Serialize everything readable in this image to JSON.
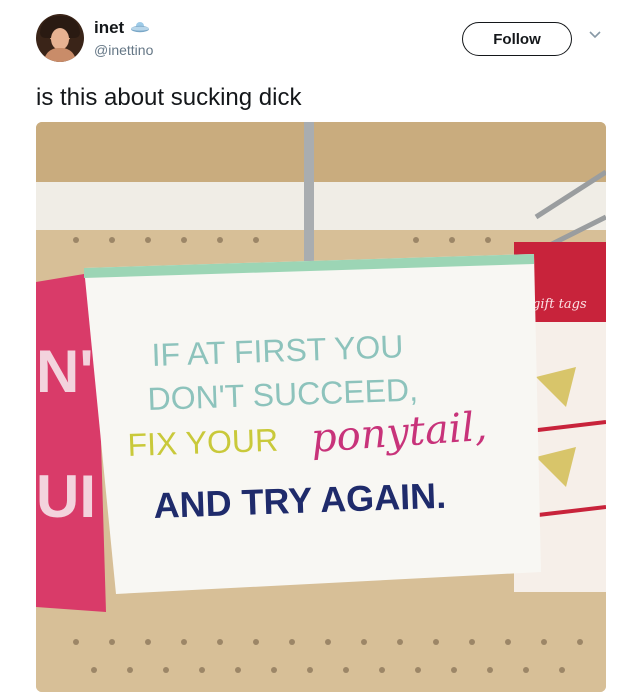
{
  "author": {
    "display_name": "inet",
    "handle": "@inettino",
    "badge_icon": "ufo-icon"
  },
  "follow_label": "Follow",
  "tweet_text": "is this about sucking dick",
  "photo": {
    "sign_lines": [
      "IF AT FIRST YOU",
      "DON'T SUCCEED,",
      "FIX YOUR",
      "ponytail,",
      "AND TRY AGAIN."
    ],
    "tag_text": "gift tags",
    "pink_sign_fragment_1": "N'",
    "pink_sign_fragment_2": "UI"
  },
  "colors": {
    "accent": "#1da1f2",
    "sign_teal": "#8dc3bc",
    "sign_yellow": "#c9c93a",
    "sign_magenta": "#c8337a",
    "sign_navy": "#1f2b6b",
    "pink_board": "#d93b69"
  }
}
